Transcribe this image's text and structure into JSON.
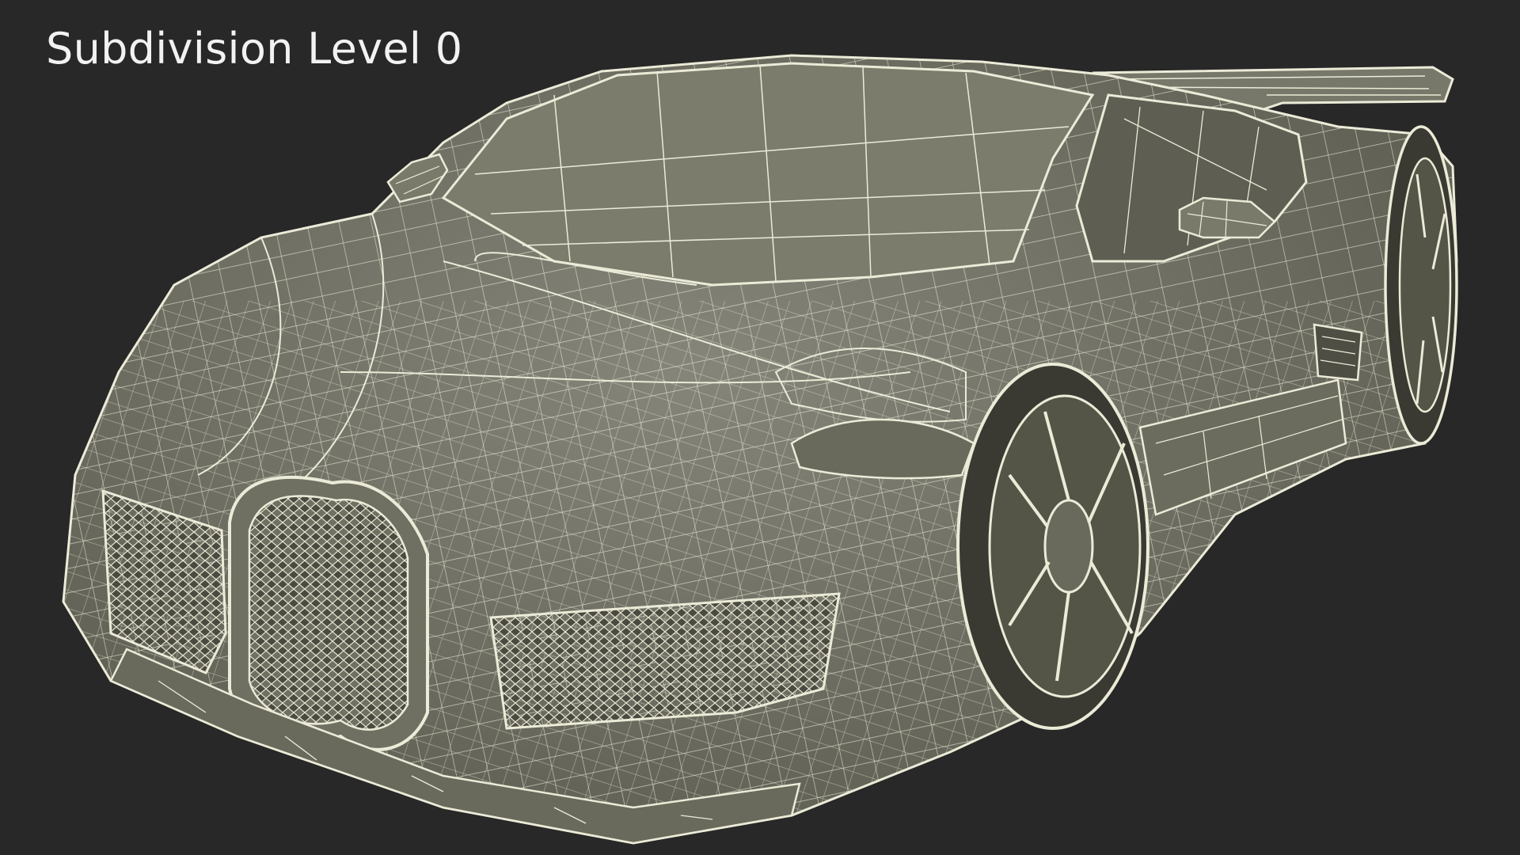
{
  "caption": "Subdivision Level 0",
  "colors": {
    "background": "#282828",
    "surface": "#7a7a68",
    "surface_dark": "#5c5c4e",
    "wire": "#ecebd8",
    "caption_text": "#f2f2f2"
  },
  "subject": "wireframe-car-model"
}
